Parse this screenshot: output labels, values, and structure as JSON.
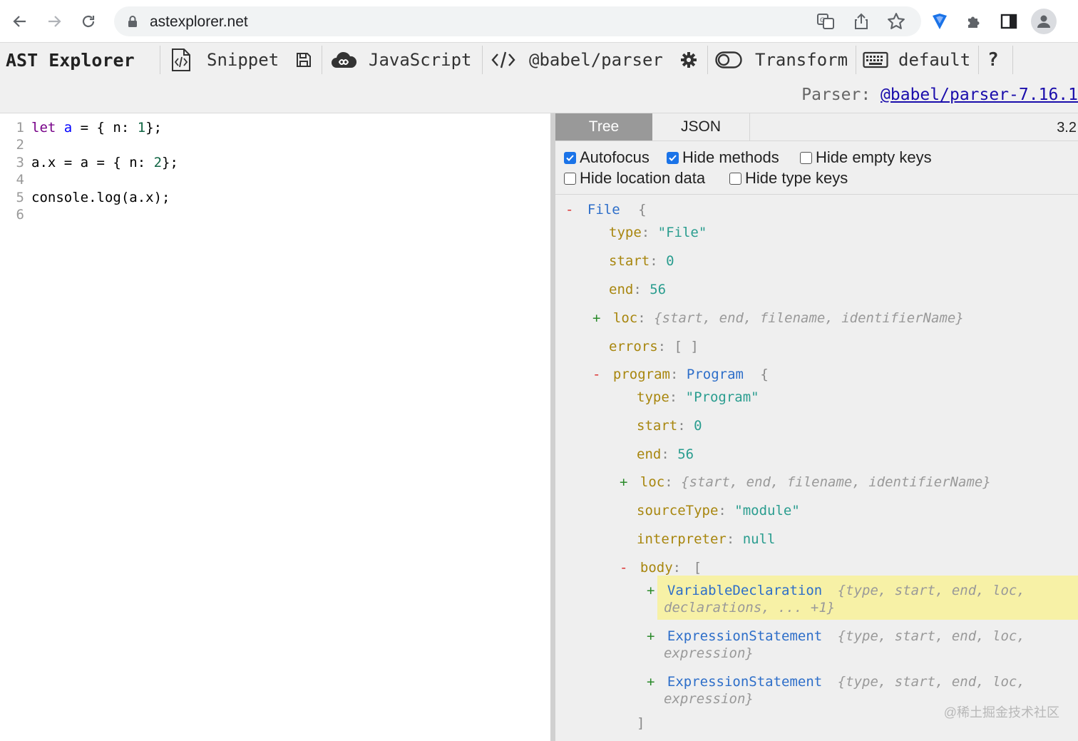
{
  "browser": {
    "url": "astexplorer.net",
    "icons": [
      "back-arrow-icon",
      "forward-arrow-icon",
      "reload-icon",
      "lock-icon",
      "translate-icon",
      "share-icon",
      "star-icon",
      "extension-shield-icon",
      "puzzle-icon",
      "sidebar-icon",
      "profile-icon"
    ]
  },
  "toolbar": {
    "logo": "AST Explorer",
    "snippet": "Snippet",
    "language": "JavaScript",
    "parser": "@babel/parser",
    "transform": "Transform",
    "keymap": "default",
    "help": "?",
    "parser_label": "Parser:",
    "parser_version": "@babel/parser-7.16.1"
  },
  "editor": {
    "lines": [
      {
        "n": "1",
        "text": "let a = { n: 1};"
      },
      {
        "n": "2",
        "text": ""
      },
      {
        "n": "3",
        "text": "a.x = a = { n: 2};"
      },
      {
        "n": "4",
        "text": ""
      },
      {
        "n": "5",
        "text": "console.log(a.x);"
      },
      {
        "n": "6",
        "text": ""
      }
    ]
  },
  "output": {
    "tabs": [
      "Tree",
      "JSON"
    ],
    "parse_time": "3.2",
    "options": [
      {
        "label": "Autofocus",
        "checked": true
      },
      {
        "label": "Hide methods",
        "checked": true
      },
      {
        "label": "Hide empty keys",
        "checked": false
      },
      {
        "label": "Hide location data",
        "checked": false
      },
      {
        "label": "Hide type keys",
        "checked": false
      }
    ],
    "tree": {
      "root_name": "File",
      "type_key": "type",
      "start_key": "start",
      "end_key": "end",
      "loc_key": "loc",
      "errors_key": "errors",
      "program_key": "program",
      "program_type": "Program",
      "source_type_key": "sourceType",
      "interpreter_key": "interpreter",
      "body_key": "body",
      "file_type": "\"File\"",
      "file_start": "0",
      "file_end": "56",
      "loc_summary": "{start, end, filename, identifierName}",
      "errors_value": "[ ]",
      "program_type_value": "\"Program\"",
      "program_start": "0",
      "program_end": "56",
      "source_type_value": "\"module\"",
      "interpreter_value": "null",
      "body_items": [
        {
          "name": "VariableDeclaration",
          "summary1": "{type, start, end, loc,",
          "summary2": "declarations, ... +1}"
        },
        {
          "name": "ExpressionStatement",
          "summary1": "{type, start, end, loc,",
          "summary2": "expression}"
        },
        {
          "name": "ExpressionStatement",
          "summary1": "{type, start, end, loc,",
          "summary2": "expression}"
        }
      ]
    },
    "watermark": "@稀土掘金技术社区"
  }
}
